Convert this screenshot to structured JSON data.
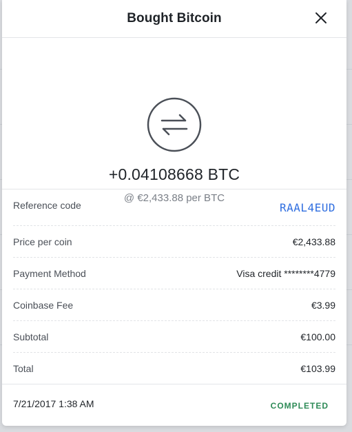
{
  "modal": {
    "title": "Bought Bitcoin",
    "close_icon": "close-icon"
  },
  "summary": {
    "icon": "swap-arrows-icon",
    "amount": "+0.04108668 BTC",
    "rate": "@ €2,433.88 per BTC"
  },
  "details": [
    {
      "label": "Reference code",
      "value": "RAAL4EUD"
    },
    {
      "label": "Price per coin",
      "value": "€2,433.88"
    },
    {
      "label": "Payment Method",
      "value": "Visa credit ********4779"
    },
    {
      "label": "Coinbase Fee",
      "value": "€3.99"
    },
    {
      "label": "Subtotal",
      "value": "€100.00"
    },
    {
      "label": "Total",
      "value": "€103.99"
    }
  ],
  "footer": {
    "timestamp": "7/21/2017 1:38 AM",
    "status": "COMPLETED"
  },
  "colors": {
    "link_blue": "#2f6ee0",
    "status_green": "#2e8b57"
  }
}
